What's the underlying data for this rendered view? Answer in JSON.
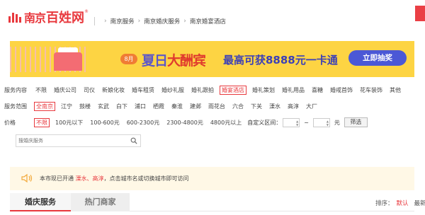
{
  "logo": {
    "text1": "南京",
    "text2": "百姓网",
    "reg": "®"
  },
  "breadcrumb": [
    "南京服务",
    "南京婚庆服务",
    "南京婚宴酒店"
  ],
  "banner": {
    "month": "8月",
    "event_a": "夏日",
    "event_b": "大酬宾",
    "promo": "最高可获8888元一卡通",
    "button": "立即抽奖"
  },
  "filters": {
    "service": {
      "label": "服务内容",
      "options": [
        "不限",
        "婚庆公司",
        "司仪",
        "新娘化妆",
        "婚车租赁",
        "婚纱礼服",
        "婚礼跟拍",
        "婚宴酒店",
        "婚礼策划",
        "婚礼用品",
        "喜糖",
        "婚戒首饰",
        "花车装饰",
        "其他"
      ],
      "active": "婚宴酒店"
    },
    "area": {
      "label": "服务范围",
      "options": [
        "全南京",
        "江宁",
        "鼓楼",
        "玄武",
        "白下",
        "浦口",
        "栖霞",
        "秦淮",
        "建邺",
        "雨花台",
        "六合",
        "下关",
        "溧水",
        "高淳",
        "大厂"
      ],
      "active": "全南京"
    },
    "price": {
      "label": "价格",
      "options": [
        "不限",
        "100元以下",
        "100-600元",
        "600-2300元",
        "2300-4800元",
        "4800元以上"
      ],
      "active": "不限",
      "custom_label": "自定义区间：",
      "tilde": "~",
      "unit": "元",
      "button": "筛选"
    }
  },
  "search": {
    "placeholder": "搜婚庆服务",
    "icon": "search-icon"
  },
  "notice": {
    "prefix": "本市现已开通 ",
    "cities": "溧水、高淳",
    "suffix": "，点击城市名或切换城市即可访问",
    "icon": "speaker-icon"
  },
  "tabs": [
    "婚庆服务",
    "热门商家"
  ],
  "sort": {
    "label": "排序：",
    "default": "默认",
    "latest": "最新"
  },
  "colors": {
    "accent": "#e8383d",
    "banner_bg": "#fdd443",
    "notice_bg": "#fff8e6"
  }
}
